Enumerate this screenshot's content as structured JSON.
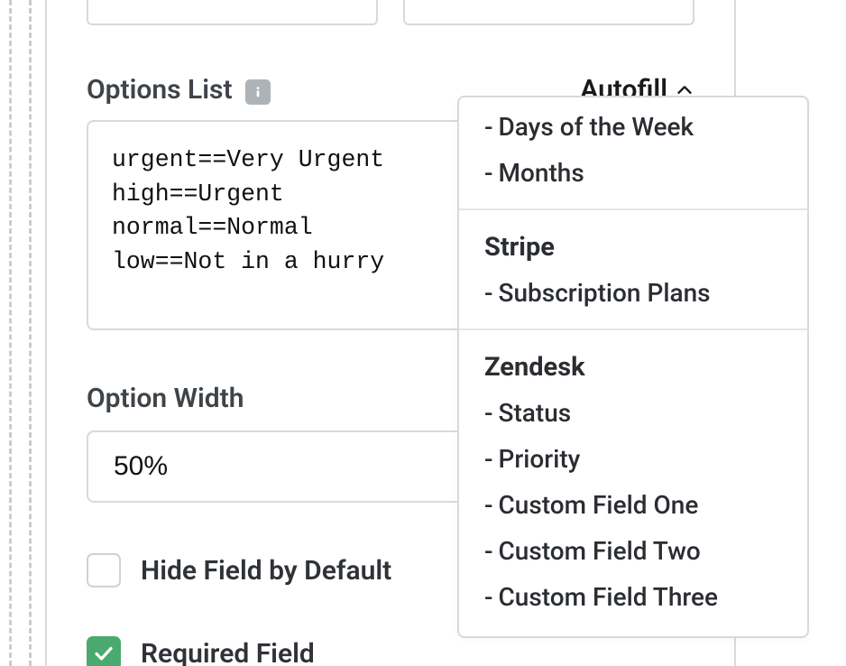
{
  "options_list": {
    "label": "Options List",
    "value": "urgent==Very Urgent\nhigh==Urgent\nnormal==Normal\nlow==Not in a hurry"
  },
  "autofill": {
    "label": "Autofill",
    "groups": [
      {
        "header": null,
        "items": [
          "Days of the Week",
          "Months"
        ]
      },
      {
        "header": "Stripe",
        "items": [
          "Subscription Plans"
        ]
      },
      {
        "header": "Zendesk",
        "items": [
          "Status",
          "Priority",
          "Custom Field One",
          "Custom Field Two",
          "Custom Field Three"
        ]
      }
    ]
  },
  "option_width": {
    "label": "Option Width",
    "value": "50%"
  },
  "checkboxes": {
    "hide_field": {
      "label": "Hide Field by Default",
      "checked": false
    },
    "required": {
      "label": "Required Field",
      "checked": true
    }
  }
}
